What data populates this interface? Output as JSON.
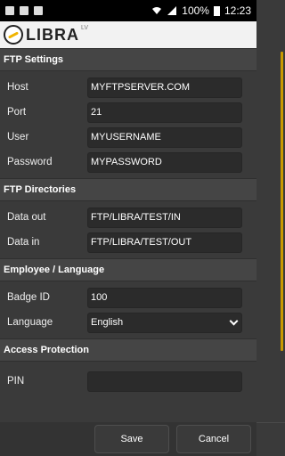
{
  "statusbar": {
    "battery": "100%",
    "time": "12:23"
  },
  "app": {
    "logo_text": "LIBRA",
    "logo_sup": "LV"
  },
  "sections": [
    {
      "title": "FTP Settings",
      "rows": [
        {
          "label": "Host",
          "value": "MYFTPSERVER.COM"
        },
        {
          "label": "Port",
          "value": "21"
        },
        {
          "label": "User",
          "value": "MYUSERNAME"
        },
        {
          "label": "Password",
          "value": "MYPASSWORD"
        }
      ]
    },
    {
      "title": "FTP Directories",
      "rows": [
        {
          "label": "Data out",
          "value": "FTP/LIBRA/TEST/IN"
        },
        {
          "label": "Data in",
          "value": "FTP/LIBRA/TEST/OUT"
        }
      ]
    },
    {
      "title": "Employee / Language",
      "rows": [
        {
          "label": "Badge ID",
          "value": "100"
        },
        {
          "label": "Language",
          "value": "English"
        }
      ]
    },
    {
      "title": "Access Protection",
      "rows": [
        {
          "label": "PIN",
          "value": ""
        }
      ]
    }
  ],
  "buttons": {
    "save": "Save",
    "cancel": "Cancel"
  },
  "colors": {
    "accent": "#c99a00"
  }
}
